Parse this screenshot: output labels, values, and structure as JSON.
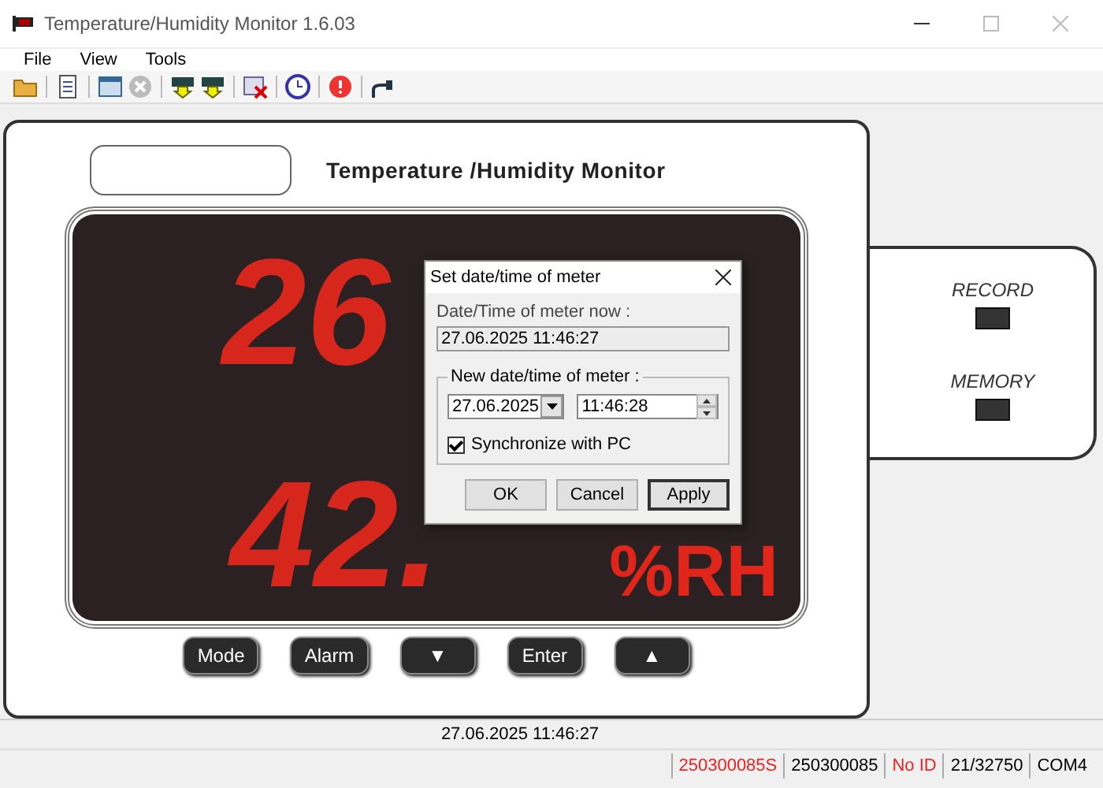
{
  "window": {
    "title": "Temperature/Humidity Monitor 1.6.03"
  },
  "menu": [
    "File",
    "View",
    "Tools"
  ],
  "device": {
    "title": "Temperature /Humidity Monitor",
    "temperature": "26",
    "humidity": "42.",
    "unit": "%RH",
    "buttons": [
      "Mode",
      "Alarm",
      "▼",
      "Enter",
      "▲"
    ]
  },
  "side_panel": {
    "indicators": [
      "RECORD",
      "MEMORY"
    ]
  },
  "dialog": {
    "title": "Set date/time of meter",
    "now_label": "Date/Time of meter now :",
    "now_value": "27.06.2025 11:46:27",
    "group_label": "New date/time of meter :",
    "date": "27.06.2025",
    "time": "11:46:28",
    "sync": {
      "label": "Synchronize with PC",
      "checked": true
    },
    "buttons": [
      {
        "label": "OK",
        "default": false
      },
      {
        "label": "Cancel",
        "default": false
      },
      {
        "label": "Apply",
        "default": true
      }
    ]
  },
  "status_bar": {
    "datetime": "27.06.2025 11:46:27",
    "panes": [
      {
        "text": "250300085S",
        "alert": true
      },
      {
        "text": "250300085",
        "alert": false
      },
      {
        "text": "No ID",
        "alert": true
      },
      {
        "text": "21/32750",
        "alert": false
      },
      {
        "text": "COM4",
        "alert": false
      }
    ]
  }
}
